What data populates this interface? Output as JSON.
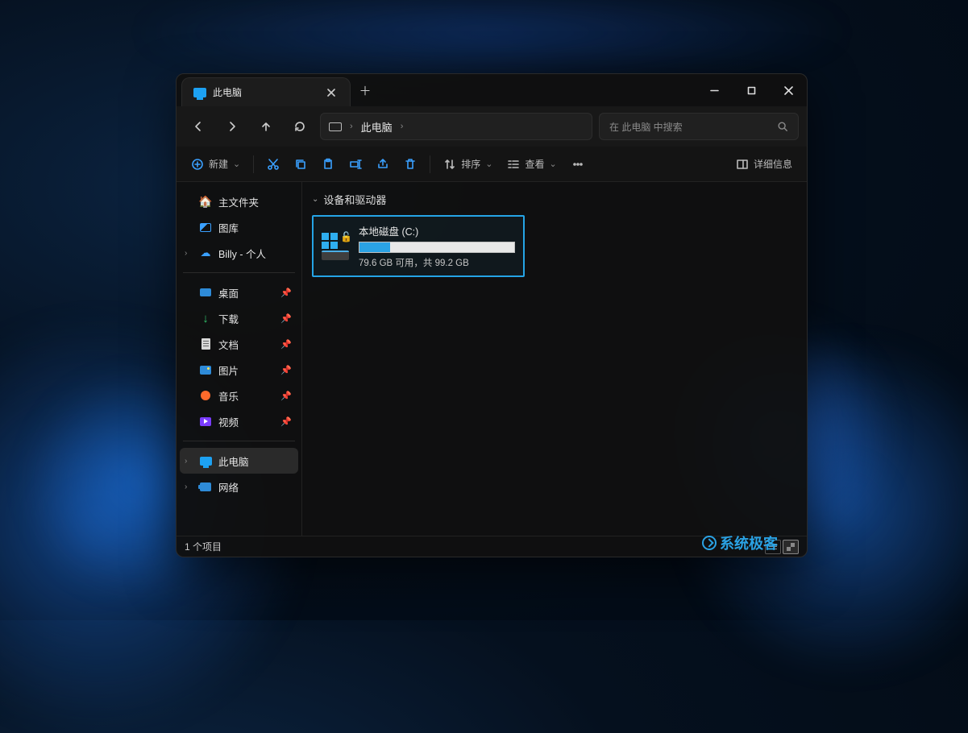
{
  "tab": {
    "title": "此电脑"
  },
  "breadcrumb": {
    "location": "此电脑"
  },
  "search": {
    "placeholder": "在 此电脑 中搜索"
  },
  "toolbar": {
    "new": "新建",
    "sort": "排序",
    "view": "查看",
    "details": "详细信息"
  },
  "sidebar": {
    "home": "主文件夹",
    "gallery": "图库",
    "onedrive": "Billy - 个人",
    "desktop": "桌面",
    "downloads": "下载",
    "documents": "文档",
    "pictures": "图片",
    "music": "音乐",
    "videos": "视频",
    "thispc": "此电脑",
    "network": "网络"
  },
  "content": {
    "group_header": "设备和驱动器",
    "drive": {
      "name": "本地磁盘 (C:)",
      "subtext": "79.6 GB 可用，共 99.2 GB",
      "used_pct": 20
    }
  },
  "status": {
    "items": "1 个项目"
  },
  "watermark": "系统极客"
}
